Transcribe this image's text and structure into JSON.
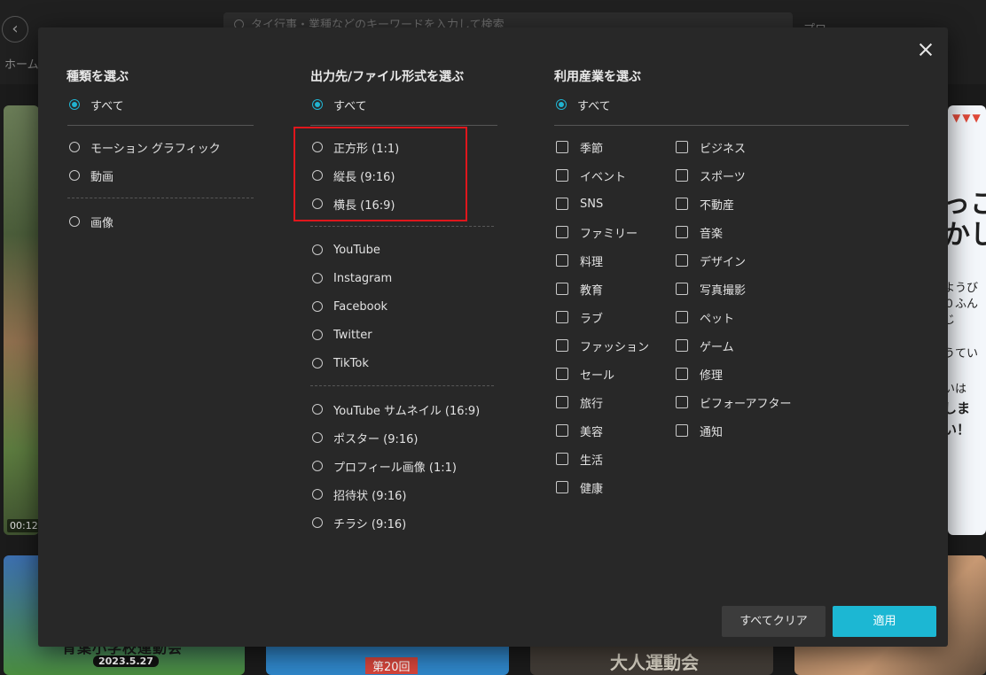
{
  "background": {
    "back_icon": "chevron-left-icon",
    "home_label": "ホーム",
    "search_placeholder": "タイ行事・業種などのキーワードを入力して検索",
    "tab_label": "プロ",
    "thumb_left_duration": "00:12",
    "right_thumb_lines": [
      "っこ",
      "かし",
      "ようび",
      "０ふん",
      "じ",
      "うてい",
      "いは",
      "しま",
      "い！"
    ],
    "bottom_thumb1_title": "青葉小学校運動会",
    "bottom_thumb1_date": "2023.5.27",
    "bottom_thumb2_label": "第20回",
    "bottom_thumb3_title": "大人運動会"
  },
  "modal": {
    "close_icon": "close-icon",
    "type": {
      "title": "種類を選ぶ",
      "all": "すべて",
      "options": [
        "モーション グラフィック",
        "動画"
      ],
      "options2": [
        "画像"
      ]
    },
    "output": {
      "title": "出力先/ファイル形式を選ぶ",
      "all": "すべて",
      "aspect": [
        "正方形 (1:1)",
        "縦長 (9:16)",
        "横長 (16:9)"
      ],
      "platforms": [
        "YouTube",
        "Instagram",
        "Facebook",
        "Twitter",
        "TikTok"
      ],
      "formats": [
        "YouTube サムネイル (16:9)",
        "ポスター (9:16)",
        "プロフィール画像 (1:1)",
        "招待状 (9:16)",
        "チラシ (9:16)"
      ]
    },
    "industry": {
      "title": "利用産業を選ぶ",
      "all": "すべて",
      "col1": [
        "季節",
        "イベント",
        "SNS",
        "ファミリー",
        "料理",
        "教育",
        "ラブ",
        "ファッション",
        "セール",
        "旅行",
        "美容",
        "生活",
        "健康"
      ],
      "col2": [
        "ビジネス",
        "スポーツ",
        "不動産",
        "音楽",
        "デザイン",
        "写真撮影",
        "ペット",
        "ゲーム",
        "修理",
        "ビフォーアフター",
        "通知"
      ]
    },
    "buttons": {
      "clear": "すべてクリア",
      "apply": "適用"
    },
    "colors": {
      "accent": "#1cb7d3",
      "highlight": "#e0161c"
    }
  }
}
